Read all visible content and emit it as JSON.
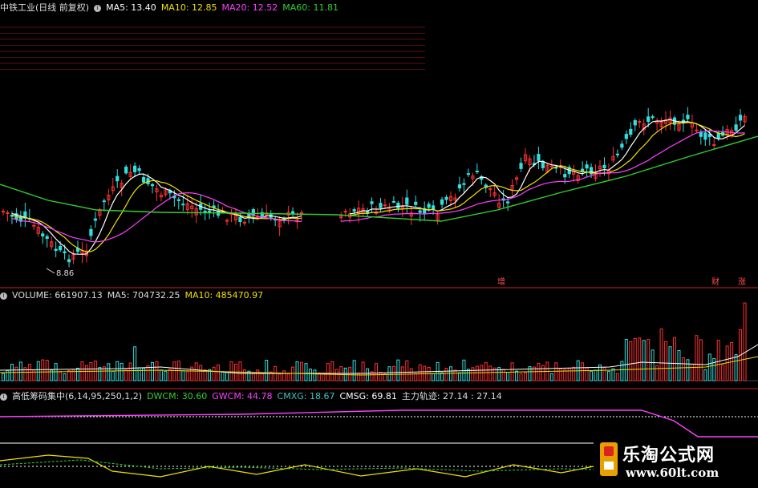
{
  "price_panel": {
    "title": "中铁工业(日线 前复权)",
    "ma_values": [
      {
        "label": "MA5: 13.40",
        "color": "#ffffff"
      },
      {
        "label": "MA10: 12.85",
        "color": "#f0e000"
      },
      {
        "label": "MA20: 12.52",
        "color": "#ff40ff"
      },
      {
        "label": "MA60: 11.81",
        "color": "#30d030"
      }
    ],
    "low_label": "8.86",
    "markers": [
      "增",
      "财",
      "涨"
    ]
  },
  "volume_panel": {
    "labels": [
      {
        "label": "VOLUME: 661907.13",
        "color": "#dddddd"
      },
      {
        "label": "MA5: 704732.25",
        "color": "#dddddd"
      },
      {
        "label": "MA10: 485470.97",
        "color": "#f0e000"
      }
    ]
  },
  "indicator_panel": {
    "title": "高低筹码集中(6,14,95,250,1,2)",
    "values": [
      {
        "label": "DWCM: 30.60",
        "color": "#30d030"
      },
      {
        "label": "GWCM: 44.78",
        "color": "#ff40ff"
      },
      {
        "label": "CMXG: 18.67",
        "color": "#40c0c0"
      },
      {
        "label": "CMSG: 69.81",
        "color": "#ffffff"
      },
      {
        "label": "主力轨迹: 27.14 : 27.14",
        "color": "#dddddd"
      }
    ]
  },
  "watermark": {
    "title": "乐淘公式网",
    "url": "www.60lt.com"
  },
  "colors": {
    "up": "#ff3030",
    "down": "#30e0e0",
    "panel_divider": "#cc2222"
  }
}
